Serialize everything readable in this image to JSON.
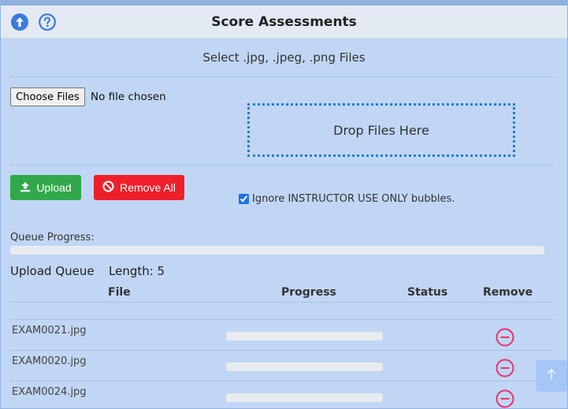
{
  "header": {
    "title": "Score Assessments",
    "upload_icon": "arrow-up-circle-icon",
    "help_icon": "question-circle-icon"
  },
  "file_select": {
    "label": "Select .jpg, .jpeg, .png Files",
    "choose_button": "Choose Files",
    "no_file_text": "No file chosen",
    "drop_zone_text": "Drop Files Here"
  },
  "actions": {
    "upload_label": "Upload",
    "upload_icon": "upload-icon",
    "remove_all_label": "Remove All",
    "remove_all_icon": "ban-icon",
    "ignore_label": "Ignore INSTRUCTOR USE ONLY bubbles.",
    "ignore_checked": true
  },
  "queue": {
    "progress_label": "Queue Progress:",
    "progress_fraction": 0,
    "title": "Upload Queue",
    "length_label": "Length: 5",
    "columns": {
      "file": "File",
      "progress": "Progress",
      "status": "Status",
      "remove": "Remove"
    },
    "rows": [
      {
        "file": "EXAM0021.jpg",
        "progress_fraction": 0,
        "status": ""
      },
      {
        "file": "EXAM0020.jpg",
        "progress_fraction": 0,
        "status": ""
      },
      {
        "file": "EXAM0024.jpg",
        "progress_fraction": 0,
        "status": ""
      }
    ]
  },
  "colors": {
    "header_bg": "#e4eaf3",
    "panel_bg": "#c0d6f4",
    "accent_blue": "#1e7fd6",
    "upload_green": "#31a94a",
    "remove_red": "#ee1f2b",
    "row_remove_pink": "#e8336b"
  }
}
